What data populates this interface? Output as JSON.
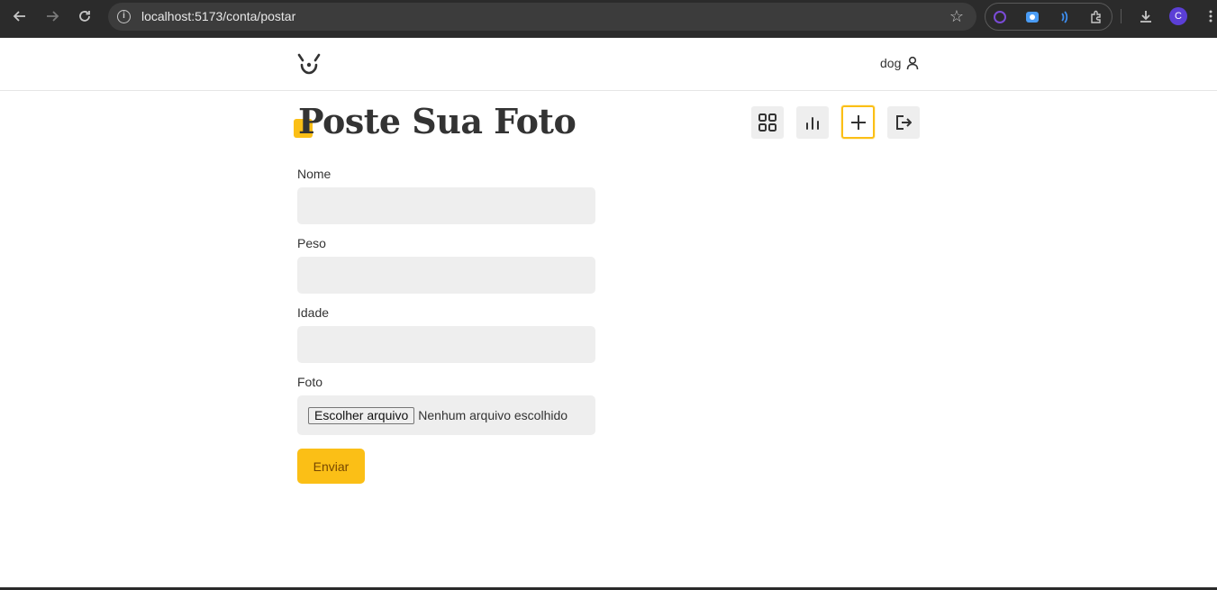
{
  "browser": {
    "url": "localhost:5173/conta/postar",
    "profile_initial": "C"
  },
  "header": {
    "logo_icon": "dog-face-logo",
    "username": "dog",
    "user_icon": "person-icon"
  },
  "page": {
    "title": "Poste Sua Foto",
    "accent_color": "#fbbf16"
  },
  "toolbar": {
    "items": [
      {
        "icon": "grid-icon",
        "active": false
      },
      {
        "icon": "stats-icon",
        "active": false
      },
      {
        "icon": "plus-icon",
        "active": true
      },
      {
        "icon": "logout-icon",
        "active": false
      }
    ]
  },
  "form": {
    "fields": [
      {
        "label": "Nome",
        "value": ""
      },
      {
        "label": "Peso",
        "value": ""
      },
      {
        "label": "Idade",
        "value": ""
      }
    ],
    "photo_label": "Foto",
    "file_button": "Escolher arquivo",
    "file_status": "Nenhum arquivo escolhido",
    "submit_label": "Enviar"
  }
}
